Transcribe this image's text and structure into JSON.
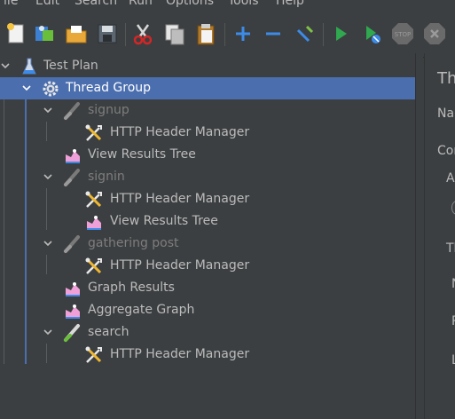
{
  "menu": [
    {
      "label": "File"
    },
    {
      "label": "Edit"
    },
    {
      "label": "Search"
    },
    {
      "label": "Run"
    },
    {
      "label": "Options"
    },
    {
      "label": "Tools"
    },
    {
      "label": "Help"
    }
  ],
  "toolbar": {
    "icons": [
      "new-icon",
      "templates-icon",
      "open-icon",
      "save-icon",
      "cut-icon",
      "copy-icon",
      "paste-icon",
      "expand-icon",
      "collapse-icon",
      "toggle-icon",
      "start-icon",
      "start-no-pauses-icon",
      "stop-icon",
      "shutdown-icon"
    ],
    "stop_text": "STOP"
  },
  "tree": {
    "items": [
      {
        "label": "Test Plan",
        "icon": "test-plan-icon"
      },
      {
        "label": "Thread Group",
        "icon": "gear-icon"
      },
      {
        "label": "signup",
        "icon": "transaction-controller-icon"
      },
      {
        "label": "HTTP Header Manager",
        "icon": "tools-icon"
      },
      {
        "label": "View Results Tree",
        "icon": "listener-icon"
      },
      {
        "label": "signin",
        "icon": "transaction-controller-icon"
      },
      {
        "label": "HTTP Header Manager",
        "icon": "tools-icon"
      },
      {
        "label": "View Results Tree",
        "icon": "listener-icon"
      },
      {
        "label": "gathering post",
        "icon": "transaction-controller-icon"
      },
      {
        "label": "HTTP Header Manager",
        "icon": "tools-icon"
      },
      {
        "label": "Graph Results",
        "icon": "listener-icon"
      },
      {
        "label": "Aggregate Graph",
        "icon": "listener-icon"
      },
      {
        "label": "search",
        "icon": "transaction-controller-icon"
      },
      {
        "label": "HTTP Header Manager",
        "icon": "tools-icon"
      }
    ]
  },
  "right_panel": {
    "title": "Th",
    "name_label": "Nam",
    "comments_label": "Com",
    "action_label": "Ac",
    "threads_label": "Th",
    "n_label": "N",
    "r_label": "R",
    "l_label": "L"
  },
  "colors": {
    "background": "#3c3f41",
    "selection": "#4b6eaf",
    "text": "#bbbbbb",
    "disabled_text": "#7d7d7d"
  }
}
